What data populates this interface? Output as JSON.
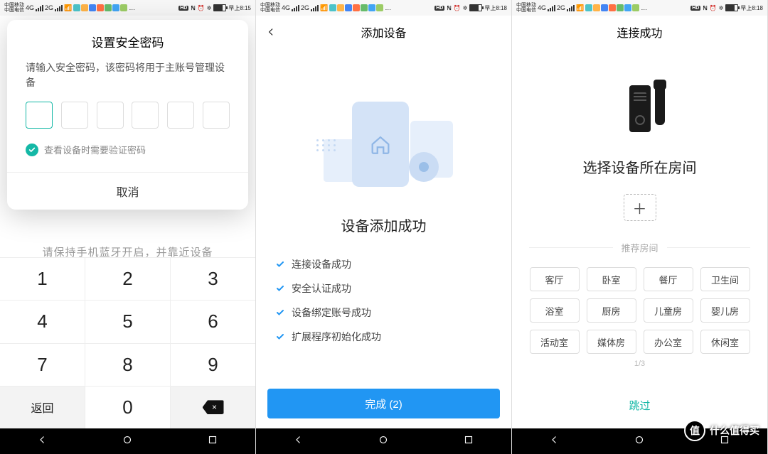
{
  "status": {
    "carrier_top": "中国移动",
    "carrier_bottom": "中国电信",
    "net_label": "4G",
    "alt_net_label": "2G",
    "hd": "HD",
    "time_s1": "早上8:15",
    "time_s23": "早上8:18"
  },
  "screen1": {
    "modal_title": "设置安全密码",
    "modal_desc": "请输入安全密码，该密码将用于主账号管理设备",
    "checkbox_label": "查看设备时需要验证密码",
    "cancel": "取消",
    "bg_hint": "请保持手机蓝牙开启，并靠近设备",
    "keypad": {
      "r1": [
        "1",
        "2",
        "3"
      ],
      "r2": [
        "4",
        "5",
        "6"
      ],
      "r3": [
        "7",
        "8",
        "9"
      ],
      "back": "返回"
    }
  },
  "screen2": {
    "header": "添加设备",
    "title": "设备添加成功",
    "steps": [
      "连接设备成功",
      "安全认证成功",
      "设备绑定账号成功",
      "扩展程序初始化成功"
    ],
    "button": "完成 (2)"
  },
  "screen3": {
    "header": "连接成功",
    "title": "选择设备所在房间",
    "sep": "推荐房间",
    "rooms": [
      "客厅",
      "卧室",
      "餐厅",
      "卫生间",
      "浴室",
      "厨房",
      "儿童房",
      "婴儿房",
      "活动室",
      "媒体房",
      "办公室",
      "休闲室"
    ],
    "pager": "1/3",
    "skip": "跳过"
  },
  "watermark": {
    "badge": "值",
    "text": "什么值得买"
  }
}
